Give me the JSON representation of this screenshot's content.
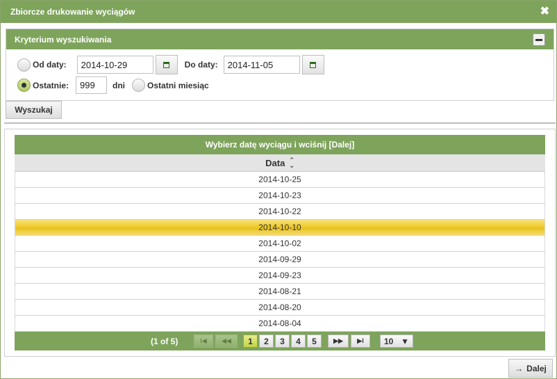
{
  "dialog": {
    "title": "Zbiorcze drukowanie wyciągów",
    "close_glyph": "✖"
  },
  "criteria": {
    "header": "Kryterium wyszukiwania",
    "from_label": "Od daty:",
    "from_value": "2014-10-29",
    "to_label": "Do daty:",
    "to_value": "2014-11-05",
    "last_label": "Ostatnie:",
    "last_value": "999",
    "days_label": "dni",
    "last_month_label": "Ostatni miesiąc",
    "selected_option": "last"
  },
  "search_button": "Wyszukaj",
  "grid": {
    "caption": "Wybierz datę wyciągu i wciśnij [Dalej]",
    "column": "Data",
    "rows": [
      "2014-10-25",
      "2014-10-23",
      "2014-10-22",
      "2014-10-10",
      "2014-10-02",
      "2014-09-29",
      "2014-09-23",
      "2014-08-21",
      "2014-08-20",
      "2014-08-04"
    ],
    "selected_row": 3
  },
  "pager": {
    "info": "(1 of 5)",
    "pages": [
      "1",
      "2",
      "3",
      "4",
      "5"
    ],
    "current_page": "1",
    "page_size": "10",
    "first_glyph": "I◀",
    "prev_glyph": "◀◀",
    "next_glyph": "▶▶",
    "last_glyph": "▶I"
  },
  "next_button": "Dalej",
  "colors": {
    "accent": "#7ea45c",
    "selected_row": "#efcb2e"
  }
}
